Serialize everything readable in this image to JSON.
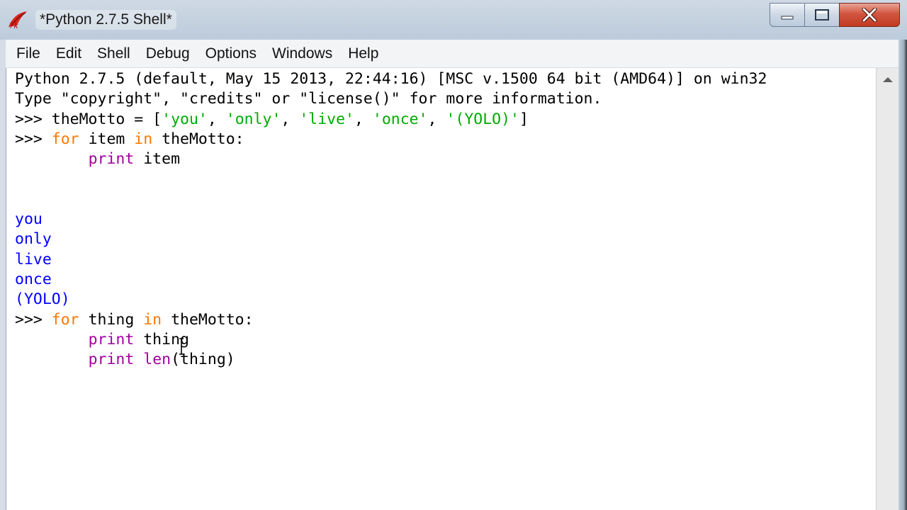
{
  "window": {
    "title": "*Python 2.7.5 Shell*",
    "icon": "tk-feather-icon"
  },
  "window_controls": {
    "minimize": "minimize-icon",
    "maximize": "maximize-icon",
    "close": "close-icon"
  },
  "menu": [
    "File",
    "Edit",
    "Shell",
    "Debug",
    "Options",
    "Windows",
    "Help"
  ],
  "shell": {
    "banner1": "Python 2.7.5 (default, May 15 2013, 22:44:16) [MSC v.1500 64 bit (AMD64)] on win32",
    "banner2": "Type \"copyright\", \"credits\" or \"license()\" for more information.",
    "prompt": ">>> ",
    "l3_a": "theMotto = [",
    "l3_s1": "'you'",
    "l3_s2": "'only'",
    "l3_s3": "'live'",
    "l3_s4": "'once'",
    "l3_s5": "'(YOLO)'",
    "l3_end": "]",
    "sep": ", ",
    "for_kw": "for",
    "in_kw": "in",
    "l4_var": " item ",
    "l4_iter": " theMotto:",
    "print_kw": "print",
    "l5_arg": " item",
    "output": [
      "you",
      "only",
      "live",
      "once",
      "(YOLO)"
    ],
    "l12_var": " thing ",
    "l12_iter": " theMotto:",
    "l13_arg": " thing",
    "len_kw": "len",
    "l14_arg": "(thing)"
  },
  "colors": {
    "keyword": "#ff7700",
    "string": "#00aa00",
    "output": "#0000ff",
    "builtin": "#a000a0"
  }
}
